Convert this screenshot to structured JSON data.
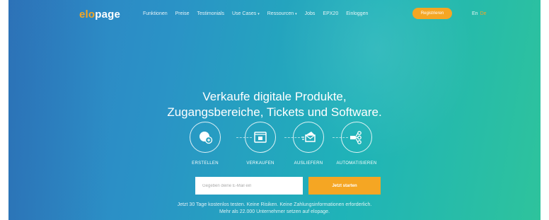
{
  "brand": {
    "logo_prefix": "elo",
    "logo_suffix": "page",
    "accent_color": "#f5a623"
  },
  "nav": {
    "items": [
      {
        "label": "Funktionen",
        "dropdown": false
      },
      {
        "label": "Preise",
        "dropdown": false
      },
      {
        "label": "Testimonials",
        "dropdown": false
      },
      {
        "label": "Use Cases",
        "dropdown": true
      },
      {
        "label": "Ressourcen",
        "dropdown": true
      },
      {
        "label": "Jobs",
        "dropdown": false
      },
      {
        "label": "EPX20",
        "dropdown": false
      },
      {
        "label": "Einloggen",
        "dropdown": false
      }
    ],
    "register_label": "Registrieren",
    "lang_en": "En",
    "lang_de": "De"
  },
  "hero": {
    "headline_line1": "Verkaufe digitale Produkte,",
    "headline_line2": "Zugangsbereiche, Tickets und Software.",
    "steps": [
      {
        "label": "ERSTELLEN",
        "icon": "create-icon"
      },
      {
        "label": "VERKAUFEN",
        "icon": "sell-icon"
      },
      {
        "label": "AUSLIEFERN",
        "icon": "deliver-icon"
      },
      {
        "label": "AUTOMATISIEREN",
        "icon": "automate-icon"
      }
    ],
    "email_placeholder": "Gegeben deine E-Mail ein",
    "cta_label": "Jetzt starten",
    "fineprint_line1": "Jetzt 30 Tage kostenlos testen. Keine Risiken. Keine Zahlungsinformationen erforderlich.",
    "fineprint_line2": "Mehr als 22.000 Unternehmer setzen auf elopage."
  }
}
